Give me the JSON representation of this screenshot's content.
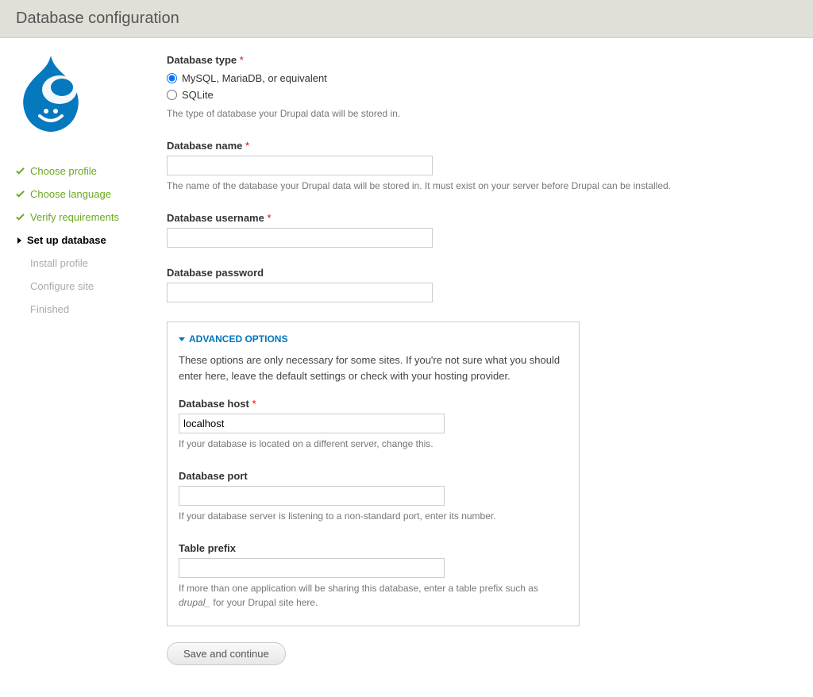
{
  "page_title": "Database configuration",
  "steps": [
    {
      "label": "Choose profile",
      "state": "done"
    },
    {
      "label": "Choose language",
      "state": "done"
    },
    {
      "label": "Verify requirements",
      "state": "done"
    },
    {
      "label": "Set up database",
      "state": "active"
    },
    {
      "label": "Install profile",
      "state": "pending"
    },
    {
      "label": "Configure site",
      "state": "pending"
    },
    {
      "label": "Finished",
      "state": "pending"
    }
  ],
  "form": {
    "dbtype": {
      "label": "Database type",
      "required": "*",
      "options": {
        "mysql": "MySQL, MariaDB, or equivalent",
        "sqlite": "SQLite"
      },
      "desc": "The type of database your Drupal data will be stored in."
    },
    "dbname": {
      "label": "Database name",
      "required": "*",
      "value": "",
      "desc": "The name of the database your Drupal data will be stored in. It must exist on your server before Drupal can be installed."
    },
    "dbuser": {
      "label": "Database username",
      "required": "*",
      "value": ""
    },
    "dbpass": {
      "label": "Database password",
      "value": ""
    },
    "advanced": {
      "title": "Advanced options",
      "intro": "These options are only necessary for some sites. If you're not sure what you should enter here, leave the default settings or check with your hosting provider.",
      "host": {
        "label": "Database host",
        "required": "*",
        "value": "localhost",
        "desc": "If your database is located on a different server, change this."
      },
      "port": {
        "label": "Database port",
        "value": "",
        "desc": "If your database server is listening to a non-standard port, enter its number."
      },
      "prefix": {
        "label": "Table prefix",
        "value": "",
        "desc_pre": "If more than one application will be sharing this database, enter a table prefix such as ",
        "desc_em": "drupal_",
        "desc_post": " for your Drupal site here."
      }
    },
    "submit": "Save and continue"
  }
}
